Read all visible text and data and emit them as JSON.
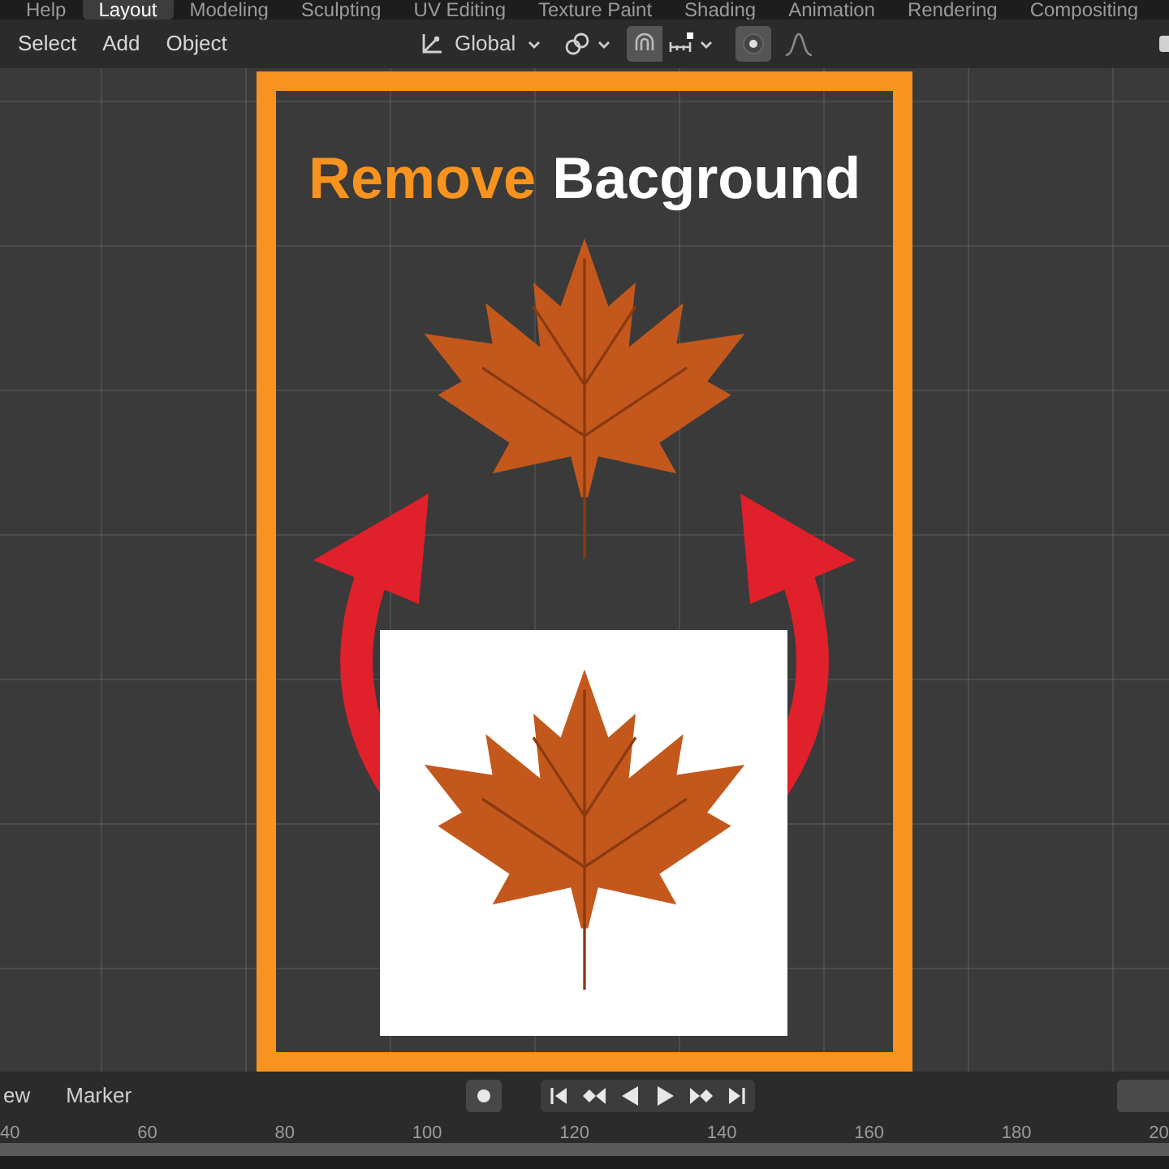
{
  "workspace_tabs": [
    {
      "label": "Help",
      "selected": false
    },
    {
      "label": "Layout",
      "selected": true
    },
    {
      "label": "Modeling",
      "selected": false
    },
    {
      "label": "Sculpting",
      "selected": false
    },
    {
      "label": "UV Editing",
      "selected": false
    },
    {
      "label": "Texture Paint",
      "selected": false
    },
    {
      "label": "Shading",
      "selected": false
    },
    {
      "label": "Animation",
      "selected": false
    },
    {
      "label": "Rendering",
      "selected": false
    },
    {
      "label": "Compositing",
      "selected": false
    }
  ],
  "header_menu": [
    "Select",
    "Add",
    "Object"
  ],
  "transform_orientation": {
    "label": "Global"
  },
  "snap": {
    "on": true
  },
  "proportional_editing": {
    "on": true
  },
  "overlay": {
    "title_parts": [
      {
        "text": "Remove",
        "color": "#f7931e"
      },
      {
        "text": "Bacground",
        "color": "#ffffff"
      }
    ]
  },
  "timeline": {
    "menu": [
      "ew",
      "Marker"
    ],
    "ruler": [
      "40",
      "60",
      "80",
      "100",
      "120",
      "140",
      "160",
      "180",
      "20"
    ]
  }
}
